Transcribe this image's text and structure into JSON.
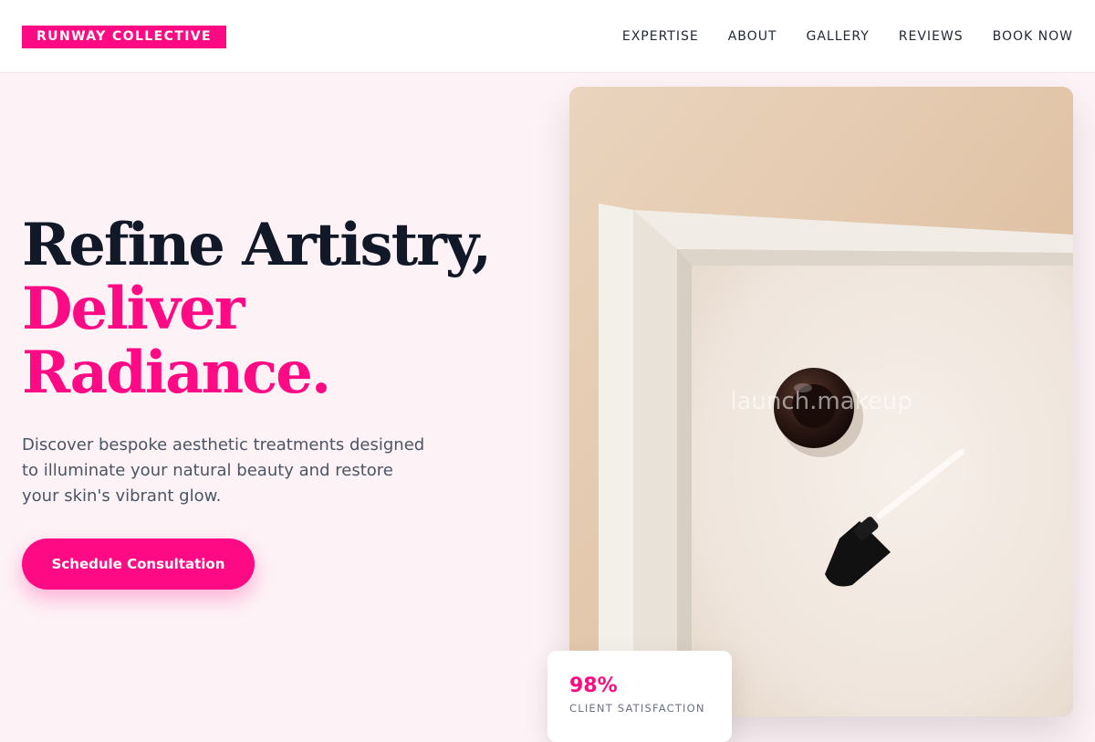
{
  "header": {
    "logo": "RUNWAY COLLECTIVE",
    "nav": [
      "EXPERTISE",
      "ABOUT",
      "GALLERY",
      "REVIEWS",
      "BOOK NOW"
    ]
  },
  "hero": {
    "headline_line1": "Refine Artistry,",
    "headline_line2": "Deliver",
    "headline_line3": "Radiance.",
    "subtitle": "Discover bespoke aesthetic treatments designed to illuminate your natural beauty and restore your skin's vibrant glow.",
    "cta_label": "Schedule Consultation",
    "image_watermark": "launch.makeup"
  },
  "stat": {
    "value": "98%",
    "label": "CLIENT SATISFACTION"
  },
  "colors": {
    "accent": "#ff0a85",
    "page_background": "#fdf2f6",
    "heading": "#111827",
    "body_text": "#4b5563"
  }
}
